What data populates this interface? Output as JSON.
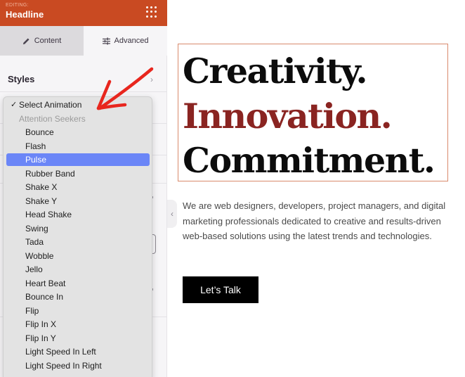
{
  "sidebar": {
    "header": {
      "editing_label": "EDITING:",
      "title": "Headline",
      "accent": "#c94a22"
    },
    "tabs": [
      {
        "label": "Content",
        "icon": "pencil-icon",
        "active": false
      },
      {
        "label": "Advanced",
        "icon": "sliders-icon",
        "active": true
      }
    ],
    "section": {
      "label": "Styles",
      "icon": "chevron-right-icon"
    }
  },
  "dropdown": {
    "items": [
      {
        "label": "Select Animation",
        "type": "checked"
      },
      {
        "label": "Attention Seekers",
        "type": "group"
      },
      {
        "label": "Bounce",
        "type": "option"
      },
      {
        "label": "Flash",
        "type": "option"
      },
      {
        "label": "Pulse",
        "type": "option",
        "highlighted": true
      },
      {
        "label": "Rubber Band",
        "type": "option"
      },
      {
        "label": "Shake X",
        "type": "option"
      },
      {
        "label": "Shake Y",
        "type": "option"
      },
      {
        "label": "Head Shake",
        "type": "option"
      },
      {
        "label": "Swing",
        "type": "option"
      },
      {
        "label": "Tada",
        "type": "option"
      },
      {
        "label": "Wobble",
        "type": "option"
      },
      {
        "label": "Jello",
        "type": "option"
      },
      {
        "label": "Heart Beat",
        "type": "option"
      },
      {
        "label": "Bounce In",
        "type": "option"
      },
      {
        "label": "Flip",
        "type": "option"
      },
      {
        "label": "Flip In X",
        "type": "option"
      },
      {
        "label": "Flip In Y",
        "type": "option"
      },
      {
        "label": "Light Speed In Left",
        "type": "option"
      },
      {
        "label": "Light Speed In Right",
        "type": "option"
      }
    ],
    "check_glyph": "✓",
    "highlight_color": "#6b86f7"
  },
  "canvas": {
    "headline": {
      "line1": "Creativity.",
      "line2": "Innovation.",
      "line3": "Commitment.",
      "accent_color": "#8a2421"
    },
    "paragraph": "We are web designers, developers, project managers, and digital marketing professionals dedicated to creative and results-driven web-based solutions using the latest trends and technologies.",
    "cta_label": "Let’s Talk"
  },
  "collapse_handle": {
    "glyph": "‹"
  }
}
